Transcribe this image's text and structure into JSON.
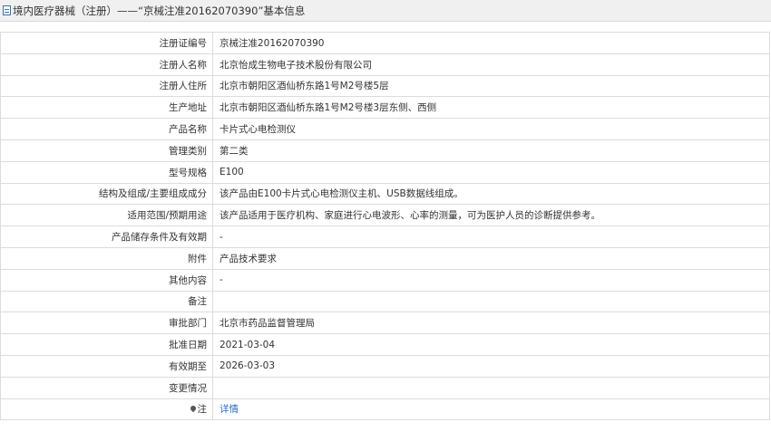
{
  "header": {
    "title": "境内医疗器械（注册）——“京械注准20162070390”基本信息",
    "icon": "document-icon"
  },
  "rows": [
    {
      "label": "注册证编号",
      "value": "京械注准20162070390"
    },
    {
      "label": "注册人名称",
      "value": "北京怡成生物电子技术股份有限公司"
    },
    {
      "label": "注册人住所",
      "value": "北京市朝阳区酒仙桥东路1号M2号楼5层"
    },
    {
      "label": "生产地址",
      "value": "北京市朝阳区酒仙桥东路1号M2号楼3层东侧、西侧"
    },
    {
      "label": "产品名称",
      "value": "卡片式心电检测仪"
    },
    {
      "label": "管理类别",
      "value": "第二类"
    },
    {
      "label": "型号规格",
      "value": "E100"
    },
    {
      "label": "结构及组成/主要组成成分",
      "value": "该产品由E100卡片式心电检测仪主机、USB数据线组成。"
    },
    {
      "label": "适用范围/预期用途",
      "value": "该产品适用于医疗机构、家庭进行心电波形、心率的测量，可为医护人员的诊断提供参考。"
    },
    {
      "label": "产品储存条件及有效期",
      "value": "-"
    },
    {
      "label": "附件",
      "value": "产品技术要求"
    },
    {
      "label": "其他内容",
      "value": "-"
    },
    {
      "label": "备注",
      "value": ""
    },
    {
      "label": "审批部门",
      "value": "北京市药品监督管理局"
    },
    {
      "label": "批准日期",
      "value": "2021-03-04"
    },
    {
      "label": "有效期至",
      "value": "2026-03-03"
    },
    {
      "label": "变更情况",
      "value": ""
    }
  ],
  "note": {
    "label": "注",
    "icon": "pin-icon",
    "link_text": "详情"
  },
  "colors": {
    "header_bg": "#f0f0f0",
    "border": "#dcdcdc",
    "link": "#2a6fc4"
  }
}
